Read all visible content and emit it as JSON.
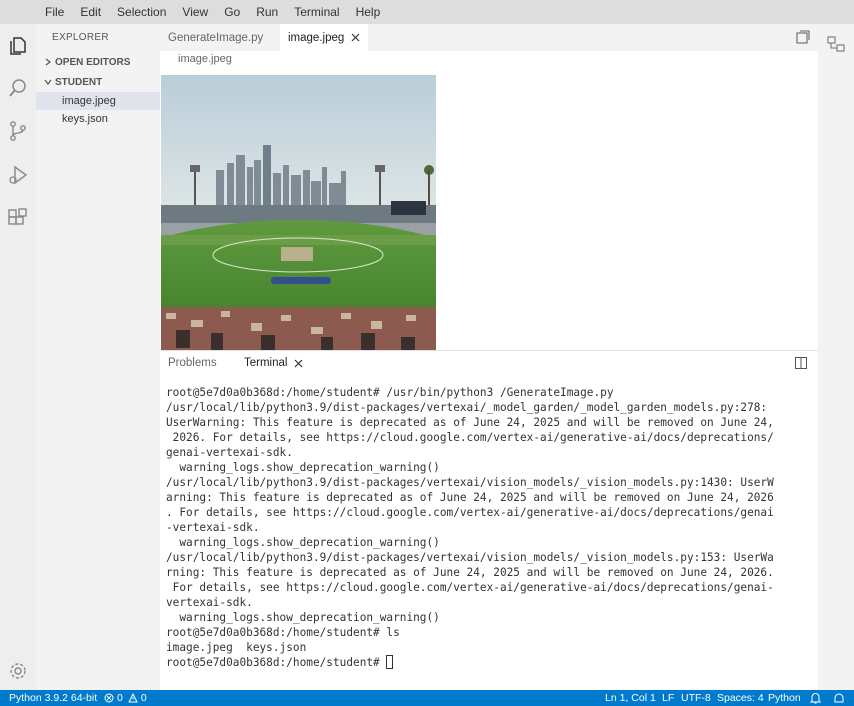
{
  "menu": [
    "File",
    "Edit",
    "Selection",
    "View",
    "Go",
    "Run",
    "Terminal",
    "Help"
  ],
  "sidebar": {
    "title": "EXPLORER",
    "open_editors": "OPEN EDITORS",
    "folder": "STUDENT",
    "files": [
      "image.jpeg",
      "keys.json"
    ]
  },
  "tabs": [
    {
      "label": "GenerateImage.py"
    },
    {
      "label": "image.jpeg"
    }
  ],
  "breadcrumb": "image.jpeg",
  "panel": {
    "tabs": [
      "Problems",
      "Terminal"
    ]
  },
  "terminal": {
    "lines": [
      "root@5e7d0a0b368d:/home/student# /usr/bin/python3 /GenerateImage.py",
      "/usr/local/lib/python3.9/dist-packages/vertexai/_model_garden/_model_garden_models.py:278:",
      "UserWarning: This feature is deprecated as of June 24, 2025 and will be removed on June 24,",
      " 2026. For details, see https://cloud.google.com/vertex-ai/generative-ai/docs/deprecations/",
      "genai-vertexai-sdk.",
      "  warning_logs.show_deprecation_warning()",
      "/usr/local/lib/python3.9/dist-packages/vertexai/vision_models/_vision_models.py:1430: UserW",
      "arning: This feature is deprecated as of June 24, 2025 and will be removed on June 24, 2026",
      ". For details, see https://cloud.google.com/vertex-ai/generative-ai/docs/deprecations/genai",
      "-vertexai-sdk.",
      "  warning_logs.show_deprecation_warning()",
      "/usr/local/lib/python3.9/dist-packages/vertexai/vision_models/_vision_models.py:153: UserWa",
      "rning: This feature is deprecated as of June 24, 2025 and will be removed on June 24, 2026.",
      " For details, see https://cloud.google.com/vertex-ai/generative-ai/docs/deprecations/genai-",
      "vertexai-sdk.",
      "  warning_logs.show_deprecation_warning()",
      "root@5e7d0a0b368d:/home/student# ls",
      "image.jpeg  keys.json"
    ],
    "prompt": "root@5e7d0a0b368d:/home/student# "
  },
  "status": {
    "python": "Python 3.9.2 64-bit",
    "errors": "0",
    "warnings": "0",
    "position": "Ln 1, Col 1",
    "eol": "LF",
    "encoding": "UTF-8",
    "spaces": "Spaces: 4",
    "language": "Python"
  },
  "icons": {
    "explorer": "files-icon",
    "search": "search-icon",
    "scm": "source-control-icon",
    "debug": "run-debug-icon",
    "extensions": "extensions-icon",
    "settings": "gear-icon"
  },
  "colors": {
    "statusbar": "#007acc",
    "menubar": "#dddddd",
    "sidebar": "#f3f3f3"
  }
}
